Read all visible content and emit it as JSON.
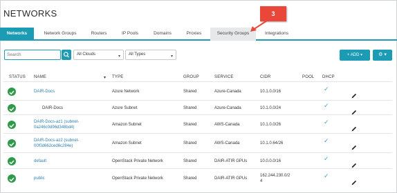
{
  "header": {
    "title": "NETWORKS"
  },
  "tabs": [
    {
      "label": "Networks",
      "active": true
    },
    {
      "label": "Network Groups"
    },
    {
      "label": "Routers"
    },
    {
      "label": "IP Pools"
    },
    {
      "label": "Domains"
    },
    {
      "label": "Proxies"
    },
    {
      "label": "Security Groups",
      "hover": true
    },
    {
      "label": "Integrations"
    }
  ],
  "callout": {
    "number": "3",
    "color": "#e8473a"
  },
  "toolbar": {
    "search_placeholder": "Search",
    "clouds_filter": "All Clouds",
    "types_filter": "All Types",
    "add_label": "+ ADD ▾",
    "settings_label": "⚙ ▾"
  },
  "table": {
    "columns": [
      "STATUS",
      "NAME",
      "▾",
      "TYPE",
      "GROUP",
      "SERVICE",
      "CIDR",
      "POOL",
      "DHCP"
    ],
    "rows": [
      {
        "status": true,
        "name": "DAIR-Docs",
        "name_line2": "",
        "indent": false,
        "type": "Azure Network",
        "group": "Shared",
        "service": "Azure-Canada",
        "cidr": "10.1.0.0/16",
        "cidr_line2": "",
        "dhcp": true
      },
      {
        "status": true,
        "name": "DAIR-Docs",
        "name_line2": "",
        "indent": true,
        "type": "Azure Subnet",
        "group": "Shared",
        "service": "Azure-Canada",
        "cidr": "10.1.0.0/24",
        "cidr_line2": "",
        "dhcp": true
      },
      {
        "status": true,
        "name": "DAIR-Docs-az1 (subnet-",
        "name_line2": "0a246c0d96d348bd4)",
        "indent": false,
        "type": "Amazon Subnet",
        "group": "Shared",
        "service": "AWS-Canada",
        "cidr": "10.1.0.0/26",
        "cidr_line2": "",
        "dhcp": true
      },
      {
        "status": true,
        "name": "DAIR-Docs-az2 (subnet-",
        "name_line2": "00f0d662ced6c284e)",
        "indent": false,
        "type": "Amazon Subnet",
        "group": "Shared",
        "service": "AWS-Canada",
        "cidr": "10.1.0.64/26",
        "cidr_line2": "",
        "dhcp": true
      },
      {
        "status": true,
        "name": "default",
        "name_line2": "",
        "indent": false,
        "type": "OpenStack Private Network",
        "group": "Shared",
        "service": "DAIR-ATIR GPUs",
        "cidr": "10.0.0.0/16",
        "cidr_line2": "",
        "dhcp": true
      },
      {
        "status": true,
        "name": "public",
        "name_line2": "",
        "indent": false,
        "type": "OpenStack Private Network",
        "group": "Shared",
        "service": "DAIR-ATIR GPUs",
        "cidr": "162.244.230.0/2",
        "cidr_line2": "4",
        "dhcp": true
      }
    ]
  },
  "colors": {
    "accent": "#1b9bb4",
    "status_ok": "#2f9a4a",
    "link": "#2a7fb0"
  }
}
